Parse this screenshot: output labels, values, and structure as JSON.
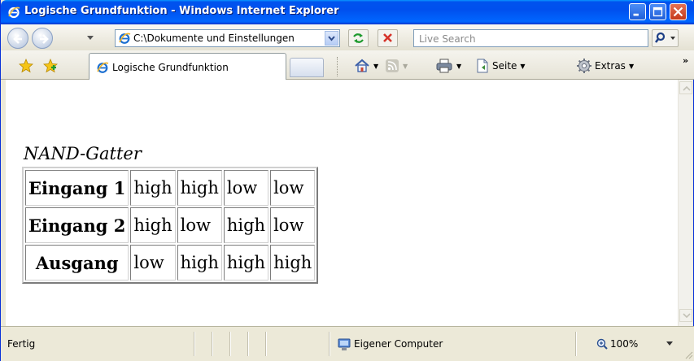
{
  "window": {
    "title": "Logische Grundfunktion - Windows Internet Explorer"
  },
  "addressbar": {
    "url": "C:\\Dokumente und Einstellungen",
    "search_placeholder": "Live Search"
  },
  "tabs": {
    "active_tab_label": "Logische Grundfunktion"
  },
  "commandbar": {
    "page_label": "Seite",
    "tools_label": "Extras"
  },
  "page": {
    "caption": "NAND-Gatter",
    "rows": [
      {
        "label": "Eingang 1",
        "values": [
          "high",
          "high",
          "low",
          "low"
        ]
      },
      {
        "label": "Eingang 2",
        "values": [
          "high",
          "low",
          "high",
          "low"
        ]
      },
      {
        "label": "Ausgang",
        "values": [
          "low",
          "high",
          "high",
          "high"
        ]
      }
    ]
  },
  "statusbar": {
    "status_text": "Fertig",
    "zone_text": "Eigener Computer",
    "zoom_text": "100%"
  },
  "colors": {
    "titlebar_blue": "#0053ee",
    "close_red": "#c53a1b",
    "chrome": "#ece9d8"
  }
}
